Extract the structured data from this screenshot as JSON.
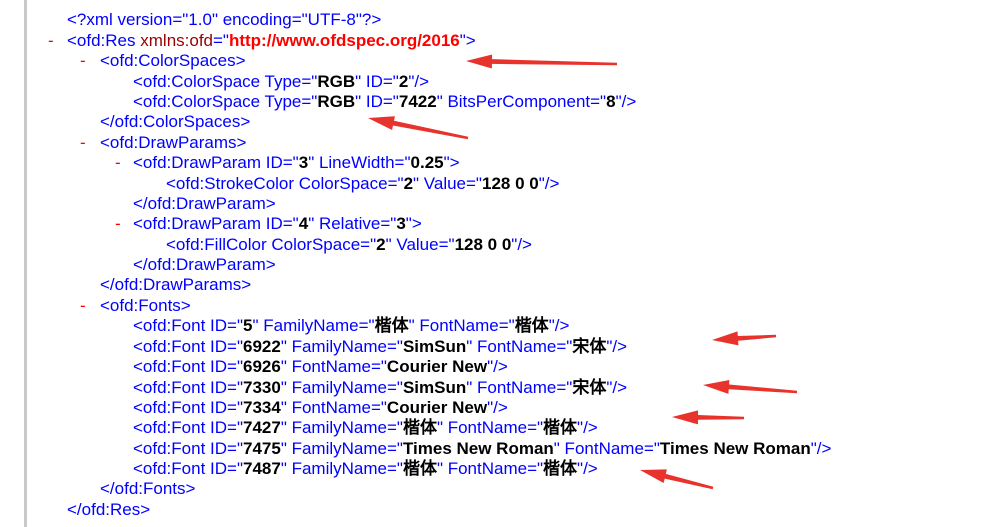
{
  "toggle_symbol": "-",
  "lines": [
    {
      "parts": [
        {
          "t": "<?xml version=\"1.0\" encoding=\"UTF-8\"?>",
          "k": "tag"
        }
      ]
    },
    {
      "parts": [
        {
          "t": "<ofd:Res ",
          "k": "tag"
        },
        {
          "t": "xmlns:ofd",
          "k": "an"
        },
        {
          "t": "=\"",
          "k": "tag"
        },
        {
          "t": "http://www.ofdspec.org/2016",
          "k": "ns"
        },
        {
          "t": "\">",
          "k": "tag"
        }
      ]
    },
    {
      "parts": [
        {
          "t": "<ofd:ColorSpaces>",
          "k": "tag"
        }
      ]
    },
    {
      "parts": [
        {
          "t": "<ofd:ColorSpace Type=\"",
          "k": "tag"
        },
        {
          "t": "RGB",
          "k": "av"
        },
        {
          "t": "\" ID=\"",
          "k": "tag"
        },
        {
          "t": "2",
          "k": "av"
        },
        {
          "t": "\"/>",
          "k": "tag"
        }
      ]
    },
    {
      "parts": [
        {
          "t": "<ofd:ColorSpace Type=\"",
          "k": "tag"
        },
        {
          "t": "RGB",
          "k": "av"
        },
        {
          "t": "\" ID=\"",
          "k": "tag"
        },
        {
          "t": "7422",
          "k": "av"
        },
        {
          "t": "\" BitsPerComponent=\"",
          "k": "tag"
        },
        {
          "t": "8",
          "k": "av"
        },
        {
          "t": "\"/>",
          "k": "tag"
        }
      ]
    },
    {
      "parts": [
        {
          "t": "</ofd:ColorSpaces>",
          "k": "tag"
        }
      ]
    },
    {
      "parts": [
        {
          "t": "<ofd:DrawParams>",
          "k": "tag"
        }
      ]
    },
    {
      "parts": [
        {
          "t": "<ofd:DrawParam ID=\"",
          "k": "tag"
        },
        {
          "t": "3",
          "k": "av"
        },
        {
          "t": "\" LineWidth=\"",
          "k": "tag"
        },
        {
          "t": "0.25",
          "k": "av"
        },
        {
          "t": "\">",
          "k": "tag"
        }
      ]
    },
    {
      "parts": [
        {
          "t": "<ofd:StrokeColor ColorSpace=\"",
          "k": "tag"
        },
        {
          "t": "2",
          "k": "av"
        },
        {
          "t": "\" Value=\"",
          "k": "tag"
        },
        {
          "t": "128 0 0",
          "k": "av"
        },
        {
          "t": "\"/>",
          "k": "tag"
        }
      ]
    },
    {
      "parts": [
        {
          "t": "</ofd:DrawParam>",
          "k": "tag"
        }
      ]
    },
    {
      "parts": [
        {
          "t": "<ofd:DrawParam ID=\"",
          "k": "tag"
        },
        {
          "t": "4",
          "k": "av"
        },
        {
          "t": "\" Relative=\"",
          "k": "tag"
        },
        {
          "t": "3",
          "k": "av"
        },
        {
          "t": "\">",
          "k": "tag"
        }
      ]
    },
    {
      "parts": [
        {
          "t": "<ofd:FillColor ColorSpace=\"",
          "k": "tag"
        },
        {
          "t": "2",
          "k": "av"
        },
        {
          "t": "\" Value=\"",
          "k": "tag"
        },
        {
          "t": "128 0 0",
          "k": "av"
        },
        {
          "t": "\"/>",
          "k": "tag"
        }
      ]
    },
    {
      "parts": [
        {
          "t": "</ofd:DrawParam>",
          "k": "tag"
        }
      ]
    },
    {
      "parts": [
        {
          "t": "</ofd:DrawParams>",
          "k": "tag"
        }
      ]
    },
    {
      "parts": [
        {
          "t": "<ofd:Fonts>",
          "k": "tag"
        }
      ]
    },
    {
      "parts": [
        {
          "t": "<ofd:Font ID=\"",
          "k": "tag"
        },
        {
          "t": "5",
          "k": "av"
        },
        {
          "t": "\" FamilyName=\"",
          "k": "tag"
        },
        {
          "t": "楷体",
          "k": "av"
        },
        {
          "t": "\" FontName=\"",
          "k": "tag"
        },
        {
          "t": "楷体",
          "k": "av"
        },
        {
          "t": "\"/>",
          "k": "tag"
        }
      ]
    },
    {
      "parts": [
        {
          "t": "<ofd:Font ID=\"",
          "k": "tag"
        },
        {
          "t": "6922",
          "k": "av"
        },
        {
          "t": "\" FamilyName=\"",
          "k": "tag"
        },
        {
          "t": "SimSun",
          "k": "av"
        },
        {
          "t": "\" FontName=\"",
          "k": "tag"
        },
        {
          "t": "宋体",
          "k": "av"
        },
        {
          "t": "\"/>",
          "k": "tag"
        }
      ]
    },
    {
      "parts": [
        {
          "t": "<ofd:Font ID=\"",
          "k": "tag"
        },
        {
          "t": "6926",
          "k": "av"
        },
        {
          "t": "\" FontName=\"",
          "k": "tag"
        },
        {
          "t": "Courier New",
          "k": "av"
        },
        {
          "t": "\"/>",
          "k": "tag"
        }
      ]
    },
    {
      "parts": [
        {
          "t": "<ofd:Font ID=\"",
          "k": "tag"
        },
        {
          "t": "7330",
          "k": "av"
        },
        {
          "t": "\" FamilyName=\"",
          "k": "tag"
        },
        {
          "t": "SimSun",
          "k": "av"
        },
        {
          "t": "\" FontName=\"",
          "k": "tag"
        },
        {
          "t": "宋体",
          "k": "av"
        },
        {
          "t": "\"/>",
          "k": "tag"
        }
      ]
    },
    {
      "parts": [
        {
          "t": "<ofd:Font ID=\"",
          "k": "tag"
        },
        {
          "t": "7334",
          "k": "av"
        },
        {
          "t": "\" FontName=\"",
          "k": "tag"
        },
        {
          "t": "Courier New",
          "k": "av"
        },
        {
          "t": "\"/>",
          "k": "tag"
        }
      ]
    },
    {
      "parts": [
        {
          "t": "<ofd:Font ID=\"",
          "k": "tag"
        },
        {
          "t": "7427",
          "k": "av"
        },
        {
          "t": "\" FamilyName=\"",
          "k": "tag"
        },
        {
          "t": "楷体",
          "k": "av"
        },
        {
          "t": "\" FontName=\"",
          "k": "tag"
        },
        {
          "t": "楷体",
          "k": "av"
        },
        {
          "t": "\"/>",
          "k": "tag"
        }
      ]
    },
    {
      "parts": [
        {
          "t": "<ofd:Font ID=\"",
          "k": "tag"
        },
        {
          "t": "7475",
          "k": "av"
        },
        {
          "t": "\" FamilyName=\"",
          "k": "tag"
        },
        {
          "t": "Times New Roman",
          "k": "av"
        },
        {
          "t": "\" FontName=\"",
          "k": "tag"
        },
        {
          "t": "Times New Roman",
          "k": "av"
        },
        {
          "t": "\"/>",
          "k": "tag"
        }
      ]
    },
    {
      "parts": [
        {
          "t": "<ofd:Font ID=\"",
          "k": "tag"
        },
        {
          "t": "7487",
          "k": "av"
        },
        {
          "t": "\" FamilyName=\"",
          "k": "tag"
        },
        {
          "t": "楷体",
          "k": "av"
        },
        {
          "t": "\" FontName=\"",
          "k": "tag"
        },
        {
          "t": "楷体",
          "k": "av"
        },
        {
          "t": "\"/>",
          "k": "tag"
        }
      ]
    },
    {
      "parts": [
        {
          "t": "</ofd:Fonts>",
          "k": "tag"
        }
      ]
    },
    {
      "parts": [
        {
          "t": "</ofd:Res>",
          "k": "tag"
        }
      ]
    }
  ],
  "colors": {
    "tag": "#0000ff",
    "attribute_name": "#990000",
    "attribute_value": "#000000",
    "namespace_value": "#ff0000",
    "toggle": "#ff0000",
    "arrow": "#e8322c"
  }
}
